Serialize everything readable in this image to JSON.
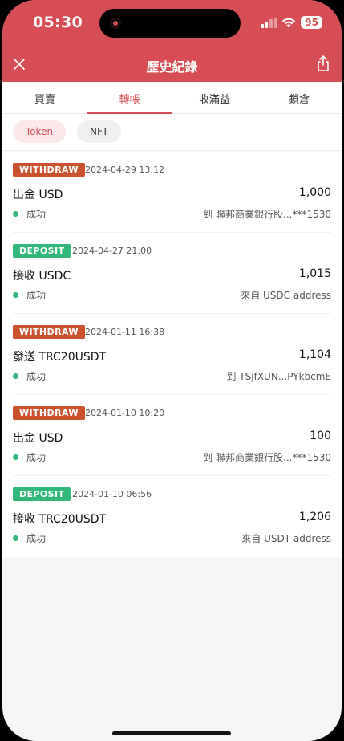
{
  "status_bar": {
    "time": "05:30",
    "battery": "95"
  },
  "nav": {
    "title": "歷史紀錄",
    "close_icon": "close-icon",
    "share_icon": "share-icon"
  },
  "tabs": [
    {
      "label": "買賣",
      "active": false
    },
    {
      "label": "轉帳",
      "active": true
    },
    {
      "label": "收滿益",
      "active": false
    },
    {
      "label": "鎖倉",
      "active": false
    }
  ],
  "filters": {
    "token": "Token",
    "nft": "NFT",
    "selected": "Token"
  },
  "transactions": [
    {
      "type": "WITHDRAW",
      "date": "2024-04-29 13:12",
      "title": "出金 USD",
      "amount": "1,000",
      "status": "成功",
      "dest": "到 聯邦商業銀行股...***1530"
    },
    {
      "type": "DEPOSIT",
      "date": "2024-04-27 21:00",
      "title": "接收 USDC",
      "amount": "1,015",
      "status": "成功",
      "dest": "來自 USDC address"
    },
    {
      "type": "WITHDRAW",
      "date": "2024-01-11 16:38",
      "title": "發送 TRC20USDT",
      "amount": "1,104",
      "status": "成功",
      "dest": "到 TSjfXUN...PYkbcmE"
    },
    {
      "type": "WITHDRAW",
      "date": "2024-01-10 10:20",
      "title": "出金 USD",
      "amount": "100",
      "status": "成功",
      "dest": "到 聯邦商業銀行股...***1530"
    },
    {
      "type": "DEPOSIT",
      "date": "2024-01-10 06:56",
      "title": "接收 TRC20USDT",
      "amount": "1,206",
      "status": "成功",
      "dest": "來自 USDT address"
    }
  ],
  "colors": {
    "brand": "#d64e54",
    "withdraw": "#c9512c",
    "deposit": "#2fb879",
    "success": "#2fb879"
  }
}
